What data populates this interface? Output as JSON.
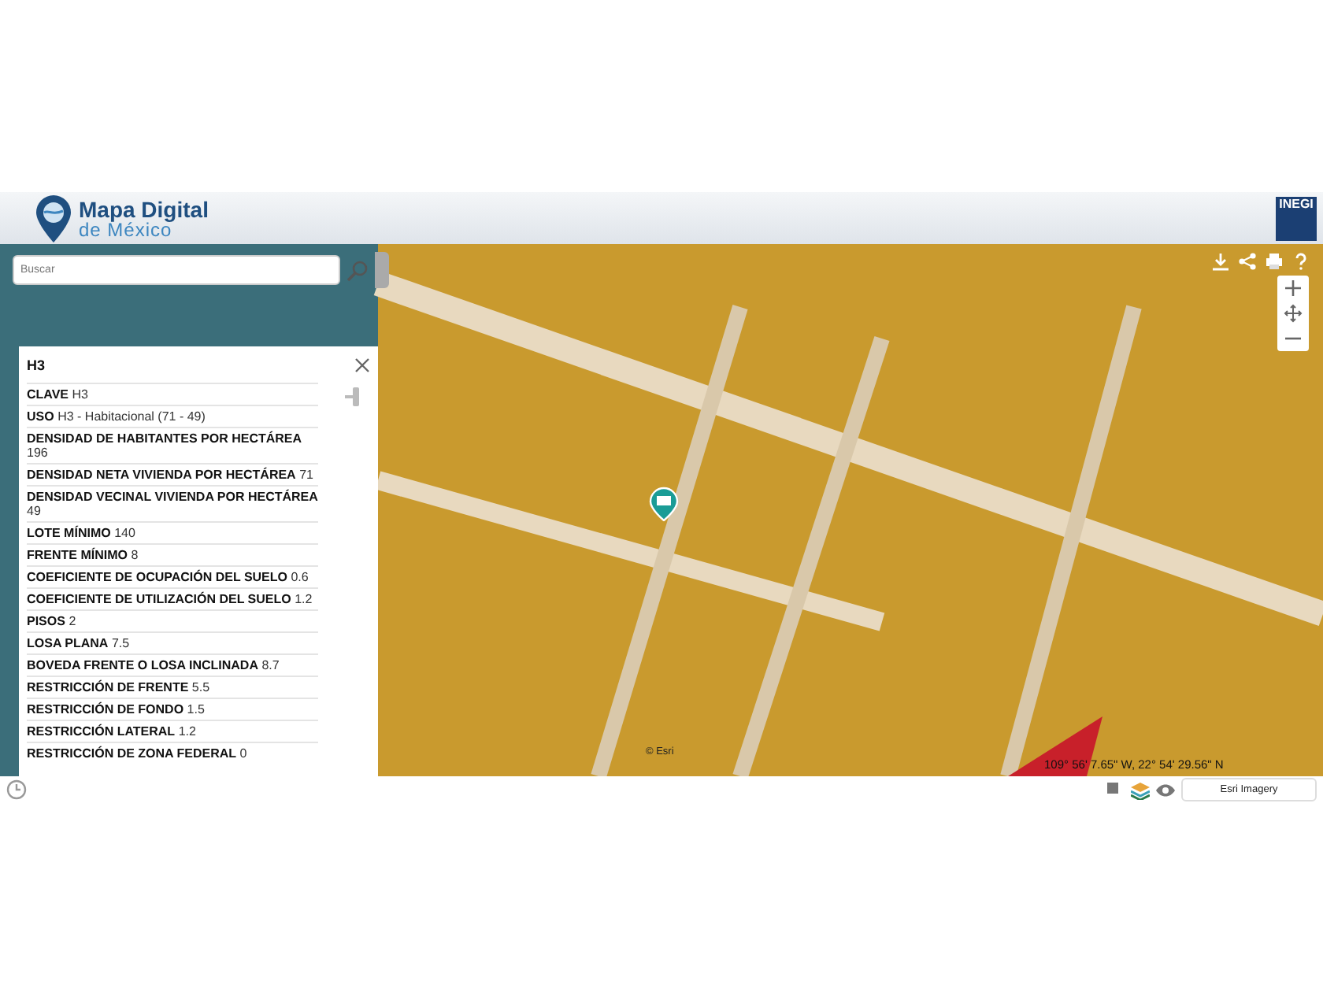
{
  "header": {
    "title": "Mapa Digital",
    "subtitle": "de México",
    "badge": "INEGI"
  },
  "search": {
    "placeholder": "Buscar"
  },
  "info_panel": {
    "title": "H3",
    "rows": [
      {
        "label": "CLAVE",
        "value": "H3"
      },
      {
        "label": "USO",
        "value": "H3 - Habitacional (71 - 49)"
      },
      {
        "label": "DENSIDAD DE HABITANTES POR HECTÁREA",
        "value": "196"
      },
      {
        "label": "DENSIDAD NETA VIVIENDA POR HECTÁREA",
        "value": "71"
      },
      {
        "label": "DENSIDAD VECINAL VIVIENDA POR HECTÁREA",
        "value": "49"
      },
      {
        "label": "LOTE MÍNIMO",
        "value": "140"
      },
      {
        "label": "FRENTE MÍNIMO",
        "value": "8"
      },
      {
        "label": "COEFICIENTE DE OCUPACIÓN DEL SUELO",
        "value": "0.6"
      },
      {
        "label": "COEFICIENTE DE UTILIZACIÓN DEL SUELO",
        "value": "1.2"
      },
      {
        "label": "PISOS",
        "value": "2"
      },
      {
        "label": "LOSA PLANA",
        "value": "7.5"
      },
      {
        "label": "BOVEDA FRENTE O LOSA INCLINADA",
        "value": "8.7"
      },
      {
        "label": "RESTRICCIÓN DE FRENTE",
        "value": "5.5"
      },
      {
        "label": "RESTRICCIÓN DE FONDO",
        "value": "1.5"
      },
      {
        "label": "RESTRICCIÓN LATERAL",
        "value": "1.2"
      },
      {
        "label": "RESTRICCIÓN DE ZONA FEDERAL",
        "value": "0"
      }
    ]
  },
  "map": {
    "coordinates": "109° 56' 7.65\" W, 22° 54' 29.56\" N",
    "attribution": "© Esri"
  },
  "basemap_button": "Esri Imagery"
}
